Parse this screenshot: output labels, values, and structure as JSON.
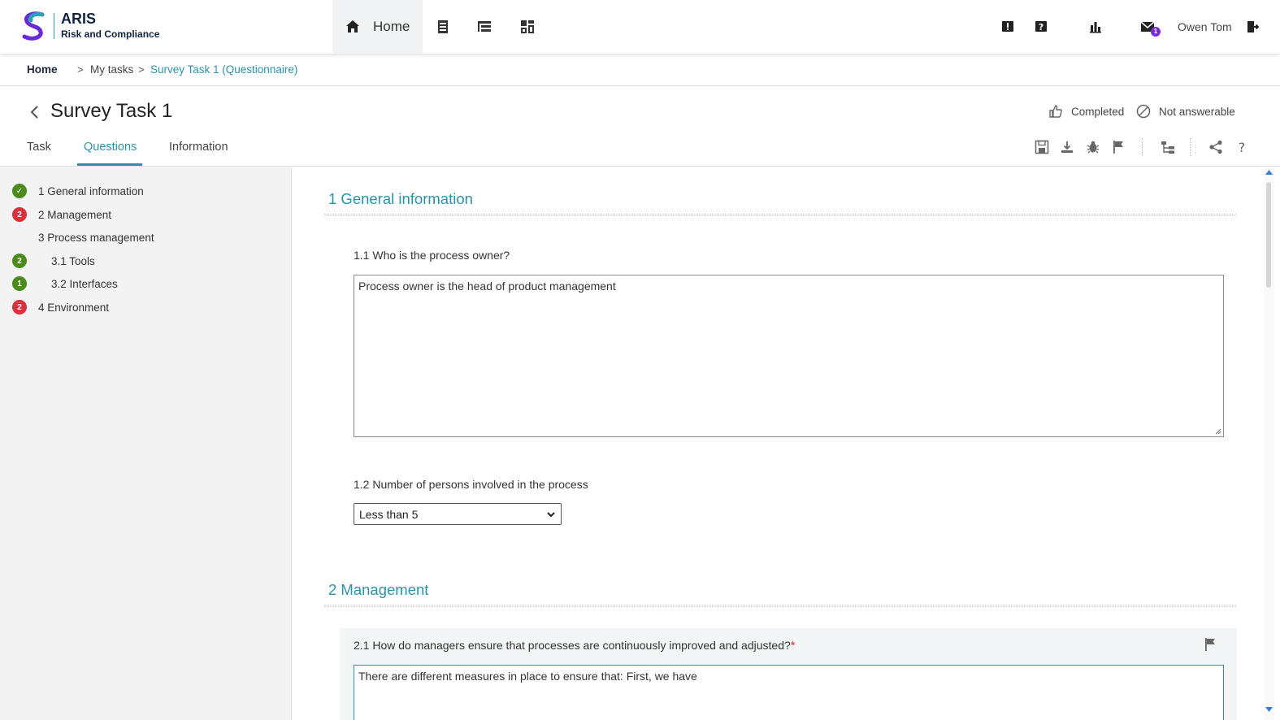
{
  "app": {
    "brand_name": "ARIS",
    "brand_subtitle": "Risk and Compliance",
    "logo_icon": "aris-s-logo",
    "accent_color": "#2a93a8"
  },
  "topnav": {
    "home_label": "Home",
    "icons": [
      "home-icon",
      "document-list-icon",
      "tree-list-icon",
      "dashboard-icon",
      "alert-icon",
      "help-icon",
      "chart-icon",
      "mail-icon",
      "logout-icon"
    ],
    "mail_badge": "1",
    "user_name": "Owen Tom"
  },
  "breadcrumb": {
    "home": "Home",
    "my_tasks": "My tasks",
    "current": "Survey Task 1 (Questionnaire)"
  },
  "header": {
    "title": "Survey Task 1",
    "completed_label": "Completed",
    "not_answerable_label": "Not answerable"
  },
  "tabs": [
    {
      "label": "Task",
      "active": false
    },
    {
      "label": "Questions",
      "active": true
    },
    {
      "label": "Information",
      "active": false
    }
  ],
  "toolbar_icons": [
    "save-icon",
    "download-icon",
    "bug-icon",
    "flag-icon",
    "hierarchy-icon",
    "share-icon",
    "help-icon"
  ],
  "sidebar": {
    "items": [
      {
        "label": "1 General information",
        "badge": "✓",
        "badge_color": "green"
      },
      {
        "label": "2 Management",
        "badge": "2",
        "badge_color": "red"
      },
      {
        "label": "3 Process management",
        "badge": "",
        "badge_color": ""
      },
      {
        "label": "3.1 Tools",
        "badge": "2",
        "badge_color": "green"
      },
      {
        "label": "3.2 Interfaces",
        "badge": "1",
        "badge_color": "green"
      },
      {
        "label": "4 Environment",
        "badge": "2",
        "badge_color": "red"
      }
    ]
  },
  "main": {
    "section1": {
      "title": "1 General information",
      "q1": {
        "label": "1.1 Who is the process owner?",
        "answer": "Process owner is the head of product management"
      },
      "q2": {
        "label": "1.2 Number of persons involved in the process",
        "selected": "Less than 5"
      }
    },
    "section2": {
      "title": "2 Management",
      "q1": {
        "label": "2.1 How do managers ensure that processes are continuously improved and adjusted?",
        "required_mark": "*",
        "answer": "There are different measures in place to ensure that: First, we have"
      }
    }
  }
}
